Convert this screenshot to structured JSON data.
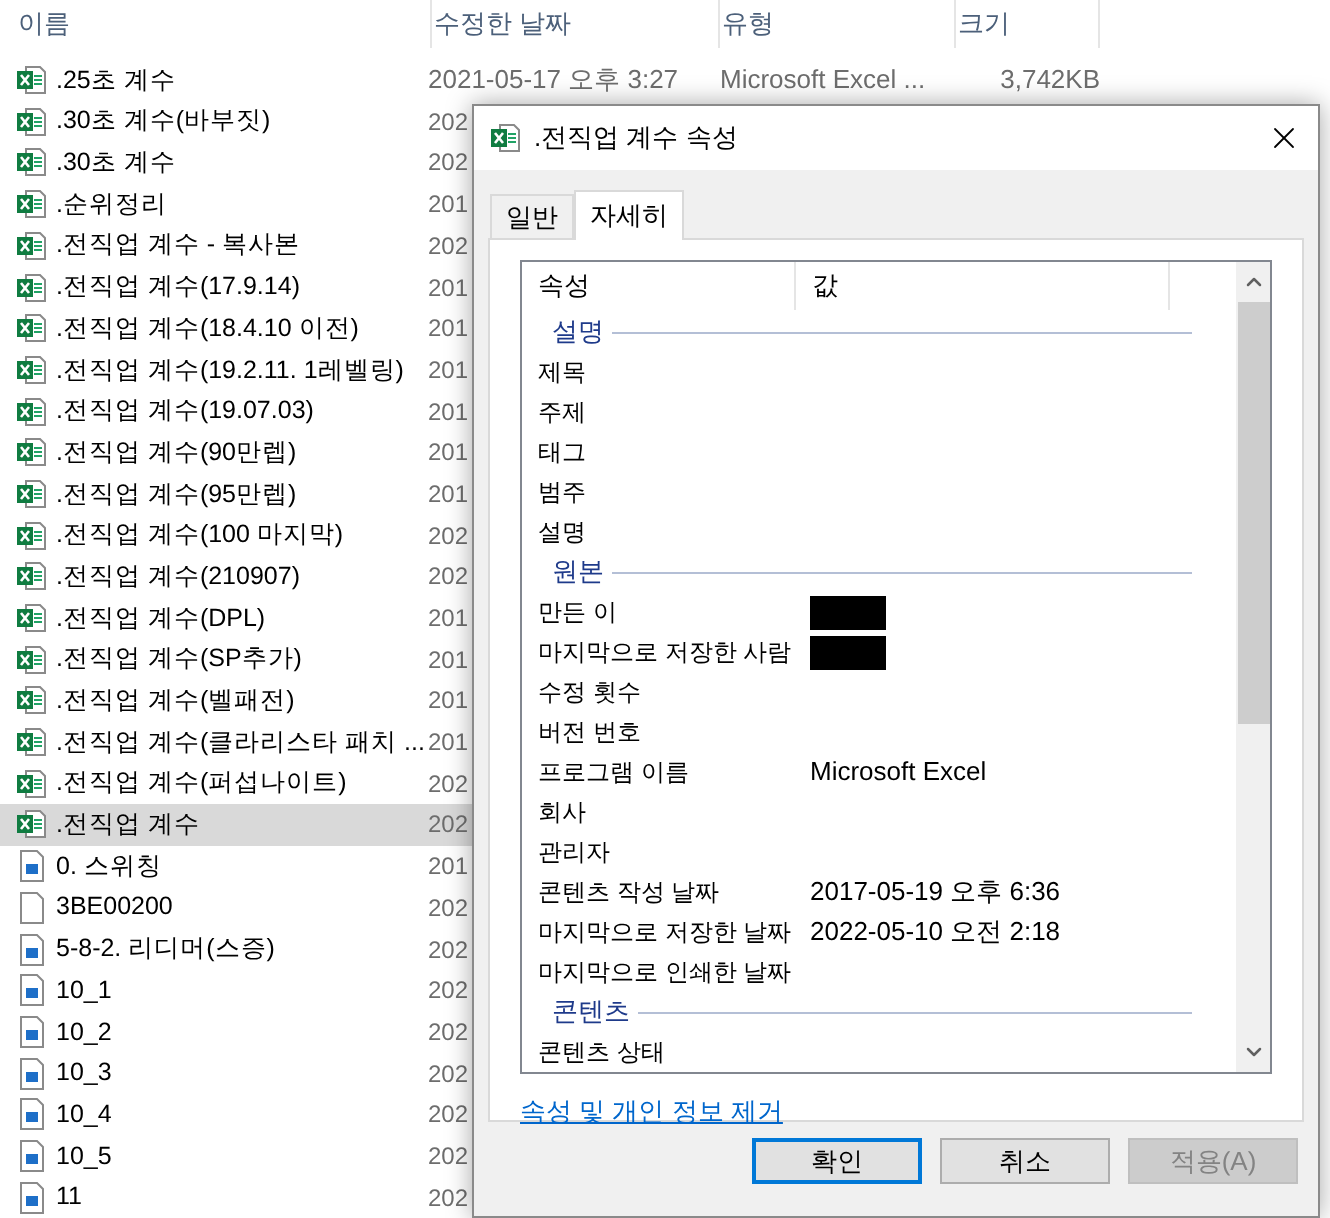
{
  "explorer": {
    "columns": [
      "이름",
      "수정한 날짜",
      "유형",
      "크기"
    ],
    "rows": [
      {
        "name": ".25초 계수",
        "kind": "excel",
        "selected": false,
        "date": "2021-05-17 오후 3:27",
        "type": "Microsoft Excel ...",
        "size": "3,742KB"
      },
      {
        "name": ".30초 계수(바부짓)",
        "kind": "excel",
        "selected": false,
        "date": "202"
      },
      {
        "name": ".30초 계수",
        "kind": "excel",
        "selected": false,
        "date": "202"
      },
      {
        "name": ".순위정리",
        "kind": "excel",
        "selected": false,
        "date": "201"
      },
      {
        "name": ".전직업 계수 - 복사본",
        "kind": "excel",
        "selected": false,
        "date": "202"
      },
      {
        "name": ".전직업 계수(17.9.14)",
        "kind": "excel",
        "selected": false,
        "date": "201"
      },
      {
        "name": ".전직업 계수(18.4.10 이전)",
        "kind": "excel",
        "selected": false,
        "date": "201"
      },
      {
        "name": ".전직업 계수(19.2.11. 1레벨링)",
        "kind": "excel",
        "selected": false,
        "date": "201"
      },
      {
        "name": ".전직업 계수(19.07.03)",
        "kind": "excel",
        "selected": false,
        "date": "201"
      },
      {
        "name": ".전직업 계수(90만렙)",
        "kind": "excel",
        "selected": false,
        "date": "201"
      },
      {
        "name": ".전직업 계수(95만렙)",
        "kind": "excel",
        "selected": false,
        "date": "201"
      },
      {
        "name": ".전직업 계수(100 마지막)",
        "kind": "excel",
        "selected": false,
        "date": "202"
      },
      {
        "name": ".전직업 계수(210907)",
        "kind": "excel",
        "selected": false,
        "date": "202"
      },
      {
        "name": ".전직업 계수(DPL)",
        "kind": "excel",
        "selected": false,
        "date": "201"
      },
      {
        "name": ".전직업 계수(SP추가)",
        "kind": "excel",
        "selected": false,
        "date": "201"
      },
      {
        "name": ".전직업 계수(벨패전)",
        "kind": "excel",
        "selected": false,
        "date": "201"
      },
      {
        "name": ".전직업 계수(클라리스타 패치 ...",
        "kind": "excel",
        "selected": false,
        "date": "201"
      },
      {
        "name": ".전직업 계수(퍼섭나이트)",
        "kind": "excel",
        "selected": false,
        "date": "202"
      },
      {
        "name": ".전직업 계수",
        "kind": "excel",
        "selected": true,
        "date": "202"
      },
      {
        "name": "0. 스위칭",
        "kind": "image",
        "selected": false,
        "date": "201"
      },
      {
        "name": "3BE00200",
        "kind": "blank",
        "selected": false,
        "date": "202"
      },
      {
        "name": "5-8-2. 리디머(스증)",
        "kind": "image",
        "selected": false,
        "date": "202"
      },
      {
        "name": "10_1",
        "kind": "image",
        "selected": false,
        "date": "202"
      },
      {
        "name": "10_2",
        "kind": "image",
        "selected": false,
        "date": "202"
      },
      {
        "name": "10_3",
        "kind": "image",
        "selected": false,
        "date": "202"
      },
      {
        "name": "10_4",
        "kind": "image",
        "selected": false,
        "date": "202"
      },
      {
        "name": "10_5",
        "kind": "image",
        "selected": false,
        "date": "202"
      },
      {
        "name": "11",
        "kind": "image",
        "selected": false,
        "date": "202"
      }
    ]
  },
  "dialog": {
    "title": ".전직업 계수 속성",
    "tabs": [
      {
        "label": "일반",
        "selected": false
      },
      {
        "label": "자세히",
        "selected": true
      }
    ],
    "columns": [
      "속성",
      "값"
    ],
    "items": [
      {
        "kind": "section",
        "label": "설명"
      },
      {
        "kind": "property",
        "name": "제목"
      },
      {
        "kind": "property",
        "name": "주제"
      },
      {
        "kind": "property",
        "name": "태그"
      },
      {
        "kind": "property",
        "name": "범주"
      },
      {
        "kind": "property",
        "name": "설명"
      },
      {
        "kind": "section",
        "label": "원본"
      },
      {
        "kind": "property",
        "name": "만든 이",
        "redacted": true
      },
      {
        "kind": "property",
        "name": "마지막으로 저장한 사람",
        "redacted": true
      },
      {
        "kind": "property",
        "name": "수정 횟수"
      },
      {
        "kind": "property",
        "name": "버전 번호"
      },
      {
        "kind": "property",
        "name": "프로그램 이름",
        "value": "Microsoft Excel"
      },
      {
        "kind": "property",
        "name": "회사"
      },
      {
        "kind": "property",
        "name": "관리자"
      },
      {
        "kind": "property",
        "name": "콘텐츠 작성 날짜",
        "value": "2017-05-19 오후 6:36"
      },
      {
        "kind": "property",
        "name": "마지막으로 저장한 날짜",
        "value": "2022-05-10 오전 2:18"
      },
      {
        "kind": "property",
        "name": "마지막으로 인쇄한 날짜"
      },
      {
        "kind": "section",
        "label": "콘텐츠"
      },
      {
        "kind": "property",
        "name": "콘텐츠 상태"
      }
    ],
    "link": "속성 및 개인 정보 제거",
    "buttons": [
      {
        "label": "확인",
        "kind": "default"
      },
      {
        "label": "취소",
        "kind": "normal"
      },
      {
        "label": "적용(A)",
        "kind": "disabled"
      }
    ]
  }
}
